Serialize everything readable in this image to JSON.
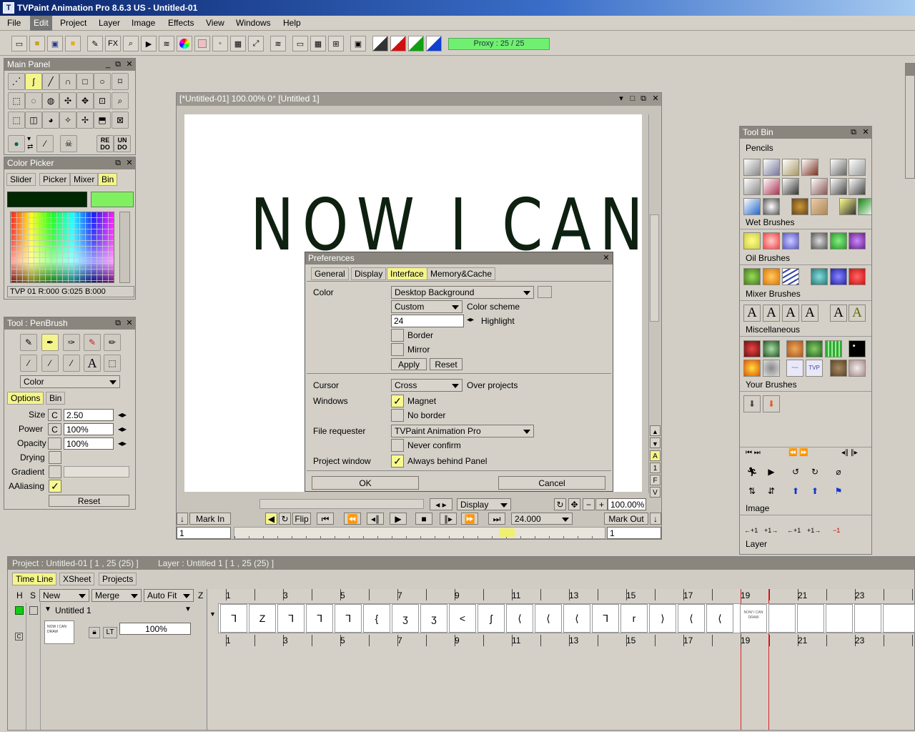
{
  "app": {
    "title": "TVPaint Animation Pro 8.6.3 US - Untitled-01",
    "menu": [
      "File",
      "Edit",
      "Project",
      "Layer",
      "Image",
      "Effects",
      "View",
      "Windows",
      "Help"
    ]
  },
  "toolbar": {
    "fx_label": "FX",
    "proxy": "Proxy : 25 / 25"
  },
  "main_panel": {
    "title": "Main Panel",
    "redo": "RE\nDO",
    "undo": "UN\nDO"
  },
  "color_picker": {
    "title": "Color Picker",
    "tabs": [
      "Slider",
      "Picker",
      "Mixer",
      "Bin"
    ],
    "status": "TVP 01 R:000 G:025 B:000",
    "primary_color": "#002800",
    "secondary_color": "#80f060"
  },
  "tool_panel": {
    "title": "Tool : PenBrush",
    "mode": "Color",
    "tabs": [
      "Options",
      "Bin"
    ],
    "rows": [
      {
        "label": "Size",
        "c": "C",
        "value": "2.50"
      },
      {
        "label": "Power",
        "c": "C",
        "value": "100%"
      },
      {
        "label": "Opacity",
        "c": "",
        "value": "100%"
      }
    ],
    "drying": "Drying",
    "gradient": "Gradient",
    "aaliasing": "AAliasing",
    "check": "✓",
    "reset": "Reset"
  },
  "canvas_window": {
    "title": "[*Untitled-01]  100.00%   0°  [Untitled 1]",
    "drawing_text": "NOW I CAN",
    "side_buttons": [
      "A",
      "1",
      "F",
      "V"
    ],
    "display": "Display",
    "zoom": "100.00%",
    "mark_in": "Mark In",
    "flip": "Flip",
    "fps": "24.000",
    "mark_out": "Mark Out",
    "frame_in": "1",
    "frame_out": "1"
  },
  "preferences": {
    "title": "Preferences",
    "tabs": [
      "General",
      "Display",
      "Interface",
      "Memory&Cache"
    ],
    "color_label": "Color",
    "color_value": "Desktop Background",
    "scheme_value": "Custom",
    "scheme_label": "Color scheme",
    "highlight_value": "24",
    "highlight_label": "Highlight",
    "border": "Border",
    "mirror": "Mirror",
    "apply": "Apply",
    "reset": "Reset",
    "cursor_label": "Cursor",
    "cursor_value": "Cross",
    "over_projects": "Over projects",
    "windows_label": "Windows",
    "magnet": "Magnet",
    "no_border": "No border",
    "file_req_label": "File requester",
    "file_req_value": "TVPaint Animation Pro",
    "never_confirm": "Never confirm",
    "project_window_label": "Project window",
    "always_behind": "Always behind Panel",
    "check": "✓",
    "ok": "OK",
    "cancel": "Cancel"
  },
  "tool_bin": {
    "title": "Tool Bin",
    "sections": [
      "Pencils",
      "Wet Brushes",
      "Oil Brushes",
      "Mixer Brushes",
      "Miscellaneous",
      "Your Brushes"
    ],
    "image_label": "Image",
    "layer_label": "Layer",
    "layer_btn_labels": [
      "←+1",
      "+1→",
      "←+1",
      "+1→",
      "−1"
    ]
  },
  "timeline": {
    "project_info": "Project : Untitled-01 [ 1 , 25  (25) ]",
    "layer_info": "Layer : Untitled 1 [ 1 , 25  (25) ]",
    "tabs": [
      "Time Line",
      "XSheet",
      "Projects"
    ],
    "h": "H",
    "s": "S",
    "new": "New",
    "merge": "Merge",
    "autofit": "Auto Fit",
    "z": "Z",
    "layer_name": "Untitled 1",
    "opacity": "100%",
    "lt": "LT",
    "frame_numbers": [
      "1",
      "3",
      "5",
      "7",
      "9",
      "11",
      "13",
      "15",
      "17",
      "19",
      "21",
      "23"
    ],
    "frame_glyphs": [
      "ᒣ",
      "Z",
      "ᒣ",
      "ᒣ",
      "ᒣ",
      "{",
      "ʒ",
      "ʒ",
      "<",
      "ʃ",
      "⟨",
      "⟨",
      "⟨",
      "ᒣ",
      "r",
      "⟩",
      "⟨",
      "⟨"
    ]
  }
}
